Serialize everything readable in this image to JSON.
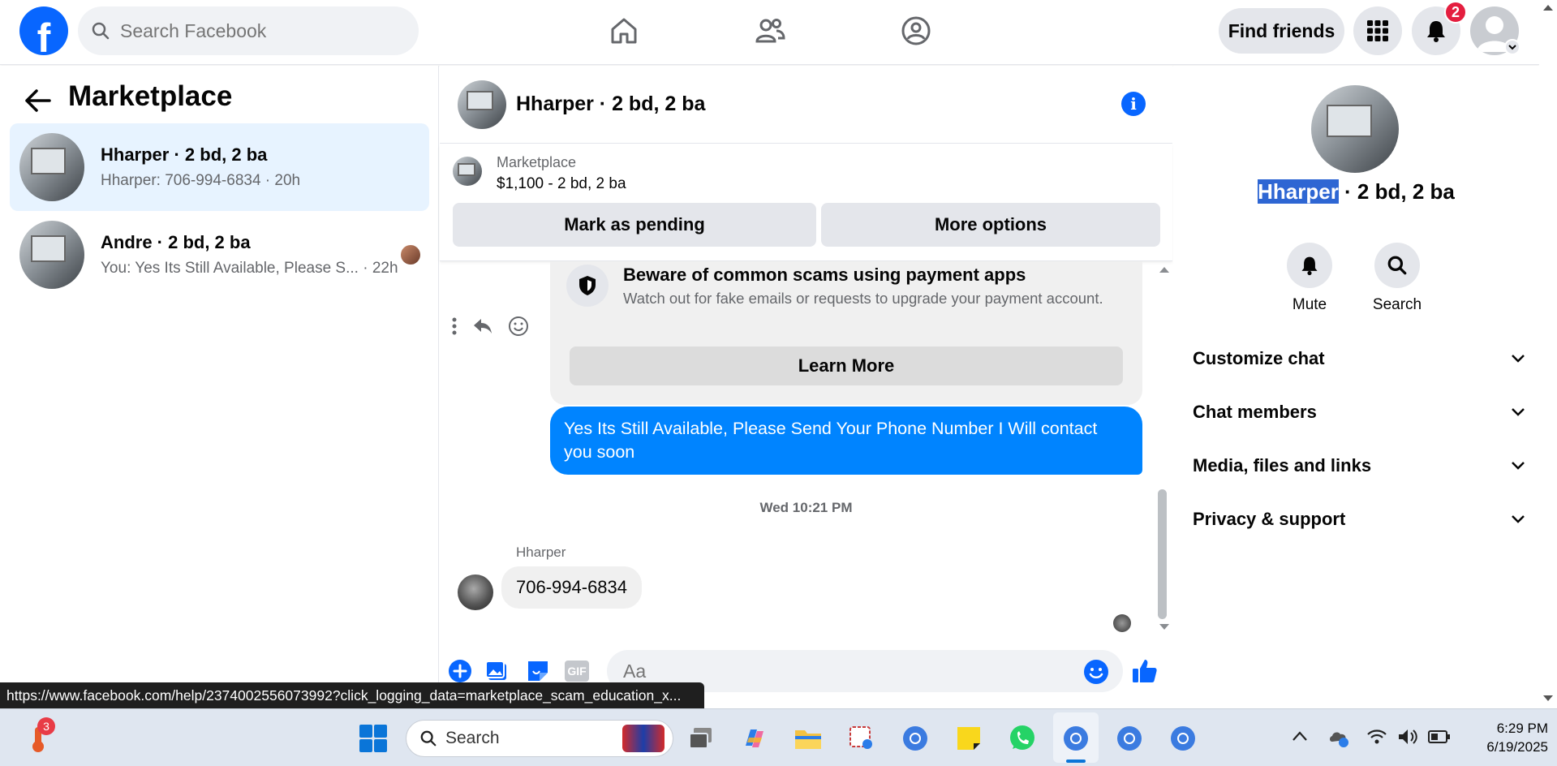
{
  "topbar": {
    "logo": "f",
    "search_placeholder": "Search Facebook",
    "find_friends": "Find friends",
    "notification_count": "2"
  },
  "left": {
    "title": "Marketplace",
    "conversations": [
      {
        "name": "Hharper · 2 bd, 2 ba",
        "preview": "Hharper: 706-994-6834 · 20h",
        "active": true
      },
      {
        "name": "Andre · 2 bd, 2 ba",
        "preview": "You: Yes Its Still Available, Please S... · 22h",
        "active": false
      }
    ]
  },
  "chat": {
    "title": "Hharper · 2 bd, 2 ba",
    "listing_label": "Marketplace",
    "listing_price": "$1,100 - 2 bd, 2 ba",
    "mark_pending": "Mark as pending",
    "more_options": "More options",
    "scam_title": "Beware of common scams using payment apps",
    "scam_desc": "Watch out for fake emails or requests to upgrade your payment account.",
    "learn_more": "Learn More",
    "outgoing_message": "Yes Its Still Available, Please Send Your Phone Number I Will contact you soon",
    "timestamp": "Wed 10:21 PM",
    "sender": "Hharper",
    "incoming_message": "706-994-6834",
    "composer_placeholder": "Aa",
    "gif_label": "GIF"
  },
  "right": {
    "name_highlight": "Hharper",
    "name_rest": " · 2 bd, 2 ba",
    "mute": "Mute",
    "search": "Search",
    "sections": [
      "Customize chat",
      "Chat members",
      "Media, files and links",
      "Privacy & support"
    ]
  },
  "status_url": "https://www.facebook.com/help/2374002556073992?click_logging_data=marketplace_scam_education_x...",
  "taskbar": {
    "weather_badge": "3",
    "search_label": "Search",
    "time": "6:29 PM",
    "date": "6/19/2025"
  },
  "colors": {
    "brand": "#0866ff",
    "bubble": "#0084ff",
    "badge": "#e41e3f"
  }
}
